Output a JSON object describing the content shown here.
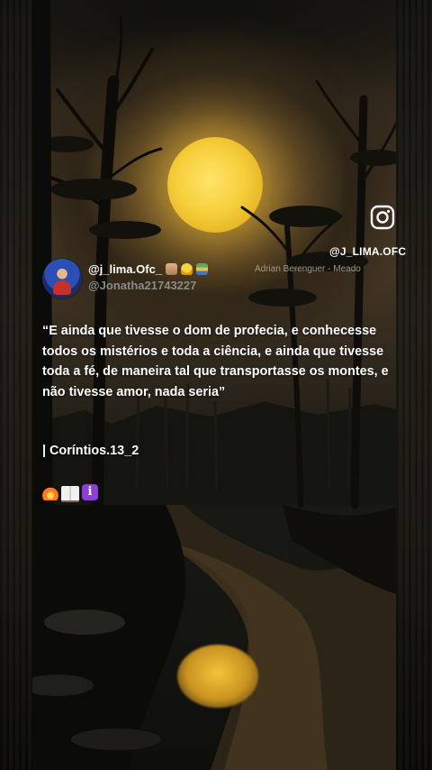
{
  "overlay": {
    "instagram_handle": "@J_LIMA.OFC",
    "artwork_credit": "Adrian Berenguer - Meado"
  },
  "post": {
    "username": "@j_lima.Ofc_",
    "secondary_handle": "@Jonatha21743227",
    "username_emojis": [
      "praying-hands",
      "bell",
      "books"
    ],
    "quote": "“E ainda que tivesse o dom de profecia, e conhecesse todos os mistérios e toda a ciência, e ainda que tivesse toda a fé, de maneira tal que transportasse os montes, e não tivesse amor, nada seria”",
    "reference": "| Coríntios.13_2",
    "footer_emojis": [
      "fire",
      "open-book",
      "information"
    ]
  },
  "colors": {
    "moon": "#f6cf3b",
    "text": "#ffffff",
    "secondary_text": "#8a8a8a"
  }
}
